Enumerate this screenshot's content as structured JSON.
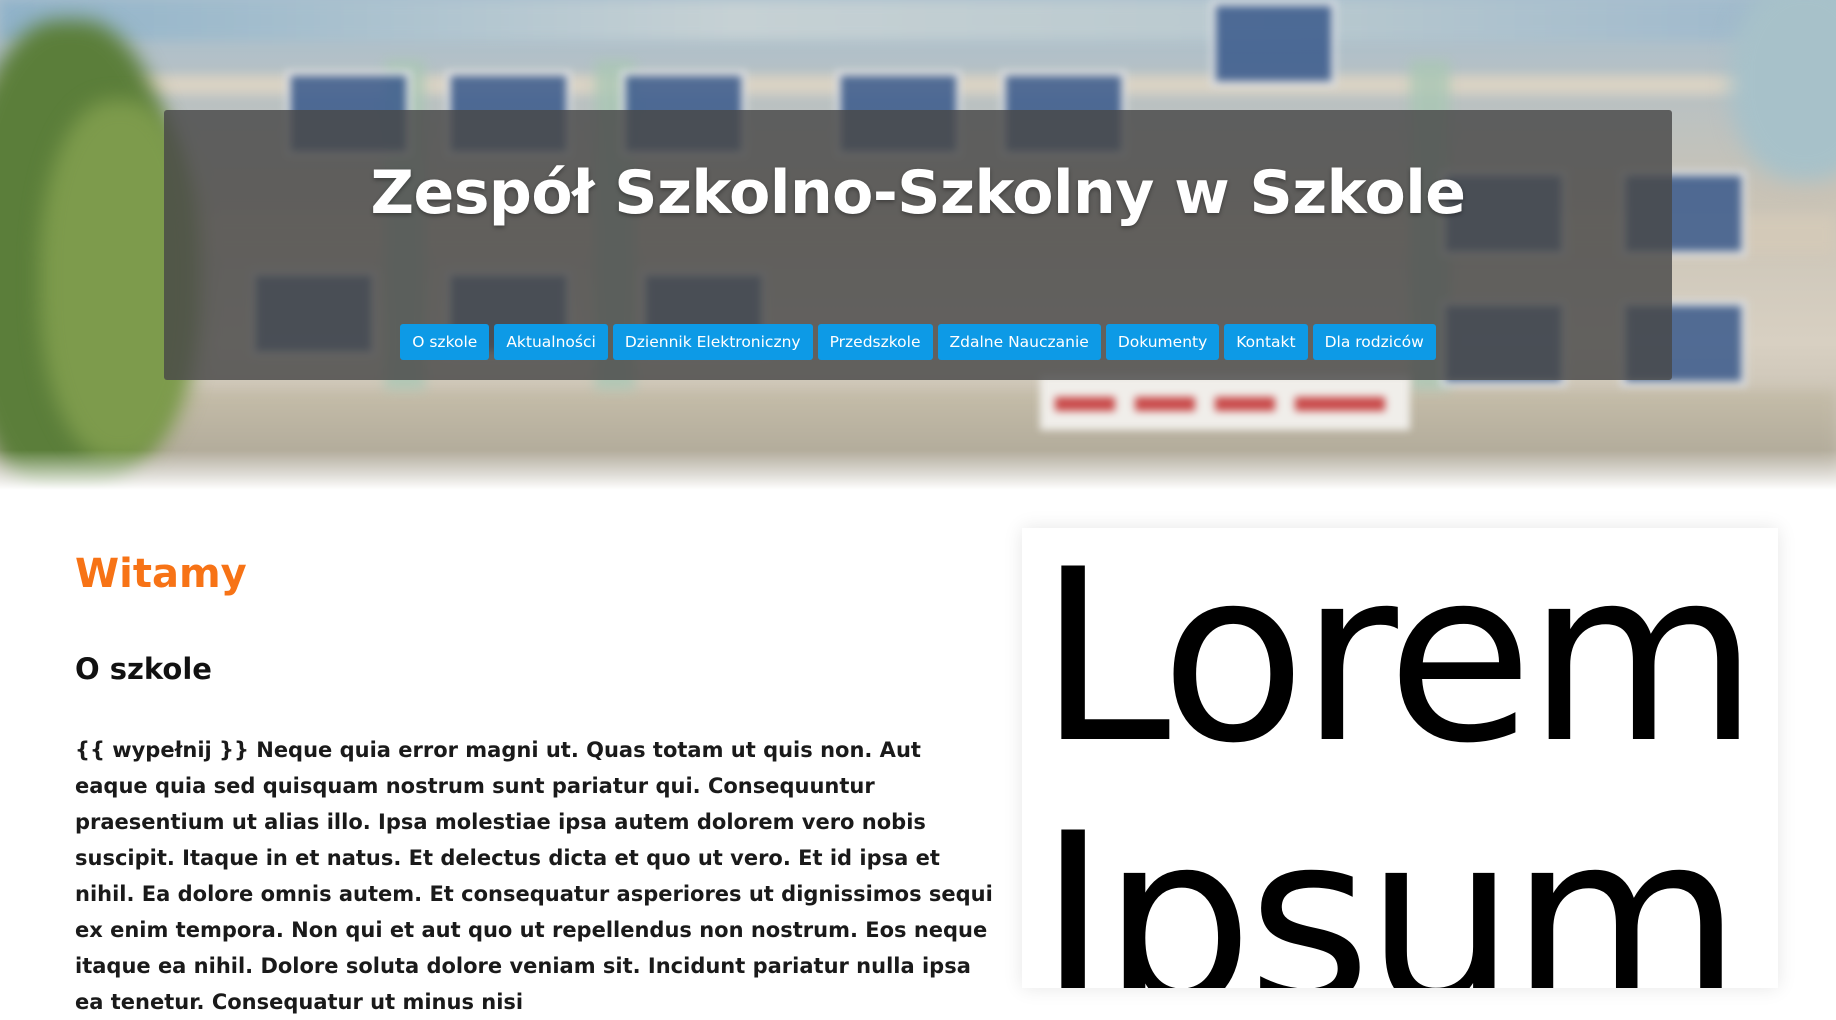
{
  "header": {
    "site_title": "Zespół Szkolno-Szkolny w Szkole",
    "background_image": "blurred-school-building-photo"
  },
  "nav": {
    "items": [
      {
        "label": "O szkole"
      },
      {
        "label": "Aktualności"
      },
      {
        "label": "Dziennik Elektroniczny"
      },
      {
        "label": "Przedszkole"
      },
      {
        "label": "Zdalne Nauczanie"
      },
      {
        "label": "Dokumenty"
      },
      {
        "label": "Kontakt"
      },
      {
        "label": "Dla rodziców"
      }
    ]
  },
  "main": {
    "welcome": "Witamy",
    "section_title": "O szkole",
    "body": "{{ wypełnij }} Neque quia error magni ut. Quas totam ut quis non. Aut eaque quia sed quisquam nostrum sunt pariatur qui. Consequuntur praesentium ut alias illo. Ipsa molestiae ipsa autem dolorem vero nobis suscipit. Itaque in et natus. Et delectus dicta et quo ut vero. Et id ipsa et nihil. Ea dolore omnis autem. Et consequatur asperiores ut dignissimos sequi ex enim tempora. Non qui et aut quo ut repellendus non nostrum. Eos neque itaque ea nihil. Dolore soluta dolore veniam sit. Incidunt pariatur nulla ipsa ea tenetur. Consequatur ut minus nisi"
  },
  "image": {
    "text": "Lorem Ipsum"
  },
  "colors": {
    "accent_orange": "#f77316",
    "nav_blue": "#0d9ae6",
    "header_panel": "#484848"
  }
}
